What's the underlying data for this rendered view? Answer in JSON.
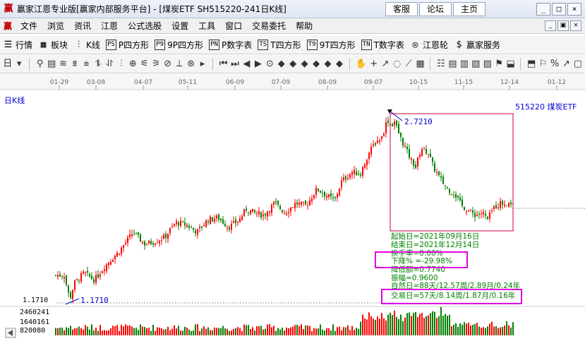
{
  "titlebar": {
    "logo": "赢",
    "title": "赢家江恩专业版[赢家内部服务平台] - [煤炭ETF  SH515220-241日K线]",
    "links": [
      "客服",
      "论坛",
      "主页"
    ],
    "controls": [
      "_",
      "□",
      "×"
    ]
  },
  "menubar": {
    "logo": "赢",
    "items": [
      "文件",
      "浏览",
      "资讯",
      "江恩",
      "公式选股",
      "设置",
      "工具",
      "窗口",
      "交易委托",
      "帮助"
    ],
    "mdi_controls": [
      "_",
      "▣",
      "×"
    ]
  },
  "toolbar1": {
    "items": [
      {
        "label": "行情",
        "icon": "grid-icon",
        "glyph": "☰"
      },
      {
        "label": "板块",
        "icon": "blocks-icon",
        "glyph": "▦"
      },
      {
        "label": "K线",
        "icon": "candle-icon",
        "glyph": "⫶"
      },
      {
        "label": "P四方形",
        "icon": "ps-icon",
        "glyph": "PS"
      },
      {
        "label": "9P四方形",
        "icon": "p9-icon",
        "glyph": "P9"
      },
      {
        "label": "P数字表",
        "icon": "pn-icon",
        "glyph": "PN"
      },
      {
        "label": "T四方形",
        "icon": "ts-icon",
        "glyph": "TS"
      },
      {
        "label": "9T四方形",
        "icon": "t9-icon",
        "glyph": "T9"
      },
      {
        "label": "T数字表",
        "icon": "tn-icon",
        "glyph": "TN"
      },
      {
        "label": "江恩轮",
        "icon": "wheel-icon",
        "glyph": "◎"
      },
      {
        "label": "赢家服务",
        "icon": "dollar-icon",
        "glyph": "$"
      }
    ]
  },
  "toolbar2": {
    "tools": [
      "日",
      "▾",
      "⚲",
      "▤",
      "≋",
      "⩩",
      "⩧",
      "⥮",
      "⥯",
      "⫶",
      "⊕",
      "⚟",
      "⚞",
      "⊘",
      "⟂",
      "⊛",
      "▸",
      "⏮",
      "⏭",
      "◀",
      "▶",
      "⊙",
      "◆",
      "◆",
      "◆",
      "◆",
      "◆",
      "◆",
      "✋",
      "+",
      "↗",
      "◌",
      "⟋",
      "▦",
      "☷",
      "▤",
      "▥",
      "▧",
      "▨",
      "⚑",
      "⬓",
      "⬒",
      "⚐",
      "%",
      "↗",
      "▢"
    ]
  },
  "timeline": {
    "dates": [
      "01-29",
      "03-08",
      "04-07",
      "05-11",
      "06-09",
      "07-09",
      "08-09",
      "09-07",
      "10-15",
      "11-15",
      "12-14",
      "01-12"
    ]
  },
  "chart_header": {
    "left": "日K线",
    "right": "515220 煤炭ETF"
  },
  "colors": {
    "up": "#ff0000",
    "down": "#008000",
    "annotation": "#0000cc",
    "stats_text": "#008000",
    "highlight_box": "#e000e0",
    "range_box": "#cc0033"
  },
  "chart_data": {
    "type": "candlestick",
    "price_axis": {
      "labels": [
        "1.1710"
      ]
    },
    "volume_axis": {
      "labels": [
        "2460241",
        "1640161",
        "820080"
      ]
    },
    "high_marker": "2.7210",
    "low_marker": "1.1710",
    "stats": [
      "起始日=2021年09月16日",
      "结束日=2021年12月14日",
      "换手率=0.00%",
      "下降% =-29.98%",
      "降低额=0.7740",
      "振幅=0.9600",
      "自然日=88天/12.57周/2.89月/0.24年",
      "交易日=57天/8.14周/1.87月/0.16年"
    ],
    "highlighted": [
      "下降% =-29.98%",
      "交易日=57天/8.14周/1.87月/0.16年"
    ],
    "ylim": [
      1.1,
      2.78
    ]
  }
}
